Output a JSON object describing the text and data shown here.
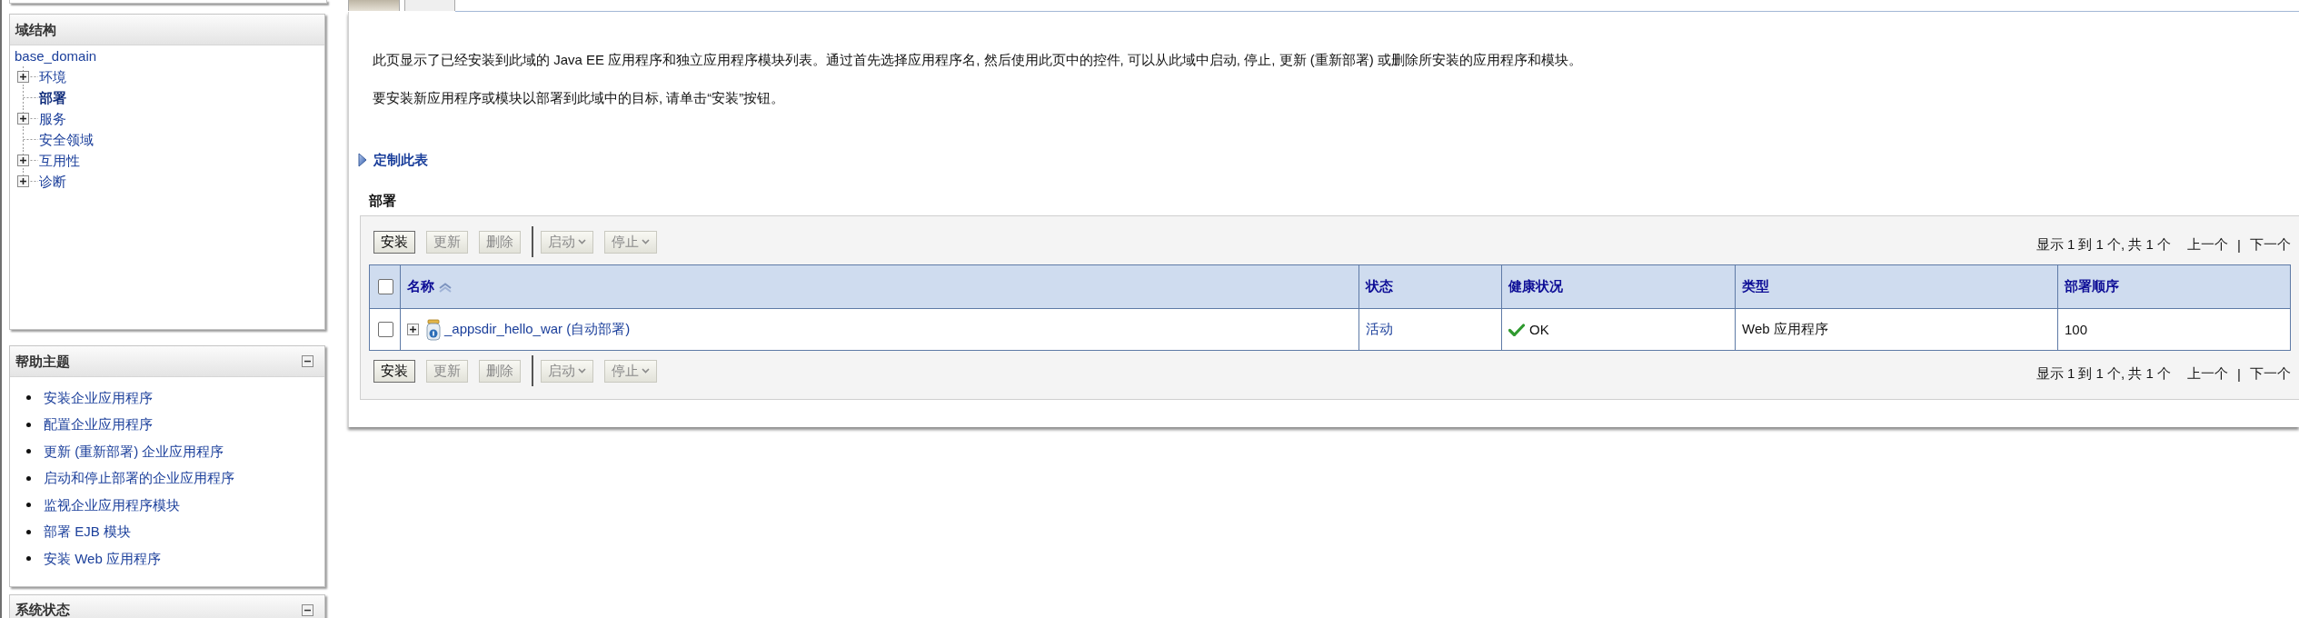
{
  "sidebar": {
    "panels": [
      {
        "kind": "tree",
        "title": "域结构",
        "tree": {
          "label": "base_domain",
          "children": [
            {
              "label": "环境",
              "expanded": false,
              "selected": false
            },
            {
              "label": "部署",
              "selected": true
            },
            {
              "label": "服务",
              "expanded": false,
              "selected": false
            },
            {
              "label": "安全领域",
              "selected": false
            },
            {
              "label": "互用性",
              "expanded": false,
              "selected": false
            },
            {
              "label": "诊断",
              "expanded": false,
              "selected": false
            }
          ]
        }
      },
      {
        "kind": "links",
        "title": "帮助主题",
        "collapsible": true,
        "links": [
          "安装企业应用程序",
          "配置企业应用程序",
          "更新 (重新部署) 企业应用程序",
          "启动和停止部署的企业应用程序",
          "监视企业应用程序模块",
          "部署 EJB 模块",
          "安装 Web 应用程序"
        ]
      },
      {
        "kind": "links",
        "title": "系统状态",
        "collapsible": true
      }
    ]
  },
  "tabs": [
    {
      "selected": true
    },
    {
      "selected": false
    }
  ],
  "intro": [
    "此页显示了已经安装到此域的 Java EE 应用程序和独立应用程序模块列表。通过首先选择应用程序名, 然后使用此页中的控件, 可以从此域中启动, 停止, 更新 (重新部署) 或删除所安装的应用程序和模块。",
    "要安装新应用程序或模块以部署到此域中的目标, 请单击“安装”按钮。"
  ],
  "customize_link": "定制此表",
  "deployments": {
    "title": "部署",
    "toolbar_top": {
      "buttons": [
        {
          "label": "安装",
          "kind": "button",
          "disabled": false
        },
        {
          "label": "更新",
          "kind": "button",
          "disabled": true
        },
        {
          "label": "删除",
          "kind": "button",
          "disabled": true
        },
        {
          "label": "启动",
          "kind": "dropdown",
          "disabled": true
        },
        {
          "label": "停止",
          "kind": "dropdown",
          "disabled": true
        }
      ],
      "pagination": {
        "summary": "显示 1 到 1 个, 共 1 个",
        "previous": {
          "label": "上一个",
          "disabled": true
        },
        "separator": "|",
        "next": {
          "label": "下一个",
          "disabled": true
        }
      }
    },
    "table": {
      "select_all": {
        "checked": false
      },
      "columns": [
        {
          "label": "名称",
          "sorted": true
        },
        {
          "label": "状态"
        },
        {
          "label": "健康状况"
        },
        {
          "label": "类型"
        },
        {
          "label": "部署顺序"
        }
      ],
      "rows": [
        {
          "checked": false,
          "expanded": false,
          "name": "_appsdir_hello_war (自动部署)",
          "state": "活动",
          "health": {
            "ok": true,
            "label": "OK"
          },
          "type": "Web 应用程序",
          "order": "100"
        }
      ]
    },
    "toolbar_bottom": {
      "buttons": [
        {
          "label": "安装",
          "kind": "button",
          "disabled": false
        },
        {
          "label": "更新",
          "kind": "button",
          "disabled": true
        },
        {
          "label": "删除",
          "kind": "button",
          "disabled": true
        },
        {
          "label": "启动",
          "kind": "dropdown",
          "disabled": true
        },
        {
          "label": "停止",
          "kind": "dropdown",
          "disabled": true
        }
      ],
      "pagination": {
        "summary": "显示 1 到 1 个, 共 1 个",
        "previous": {
          "label": "上一个",
          "disabled": true
        },
        "separator": "|",
        "next": {
          "label": "下一个",
          "disabled": true
        }
      }
    }
  }
}
